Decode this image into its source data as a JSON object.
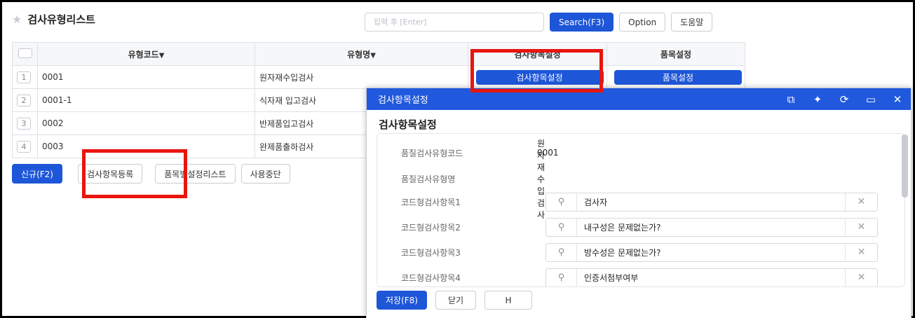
{
  "page": {
    "title": "검사유형리스트",
    "star_icon": "star-icon"
  },
  "search": {
    "placeholder": "입력 후 [Enter]",
    "search_label": "Search(F3)",
    "option_label": "Option",
    "help_label": "도움말"
  },
  "grid": {
    "headers": {
      "code": "유형코드",
      "name": "유형명",
      "inspect": "검사항목설정",
      "item": "품목설정"
    },
    "sort_arrow": "▼",
    "rows": [
      {
        "num": "1",
        "code": "0001",
        "name": "원자재수입검사",
        "inspect_btn": "검사항목설정",
        "item_btn": "품목설정"
      },
      {
        "num": "2",
        "code": "0001-1",
        "name": "식자재 입고검사"
      },
      {
        "num": "3",
        "code": "0002",
        "name": "반제품입고검사"
      },
      {
        "num": "4",
        "code": "0003",
        "name": "완제품출하검사"
      }
    ]
  },
  "actions": {
    "new_label": "신규(F2)",
    "register_label": "검사항목등록",
    "item_list_label": "품목별설정리스트",
    "disable_label": "사용중단"
  },
  "modal": {
    "bar_title": "검사항목설정",
    "title": "검사항목설정",
    "fields": [
      {
        "label": "품질검사유형코드",
        "value": "0001"
      },
      {
        "label": "품질검사유형명",
        "value": "원자재수입검사"
      }
    ],
    "lookups": [
      {
        "label": "코드형검사항목1",
        "value": "검사자"
      },
      {
        "label": "코드형검사항목2",
        "value": "내구성은 문제없는가?"
      },
      {
        "label": "코드형검사항목3",
        "value": "방수성은 문제없는가?"
      },
      {
        "label": "코드형검사항목4",
        "value": "인증서첨부여부"
      }
    ],
    "save_label": "저장(F8)",
    "close_label": "닫기",
    "h_label": "H"
  },
  "colors": {
    "primary": "#1e56d8",
    "modal_bar": "#2059dd",
    "highlight": "#e8150e"
  }
}
